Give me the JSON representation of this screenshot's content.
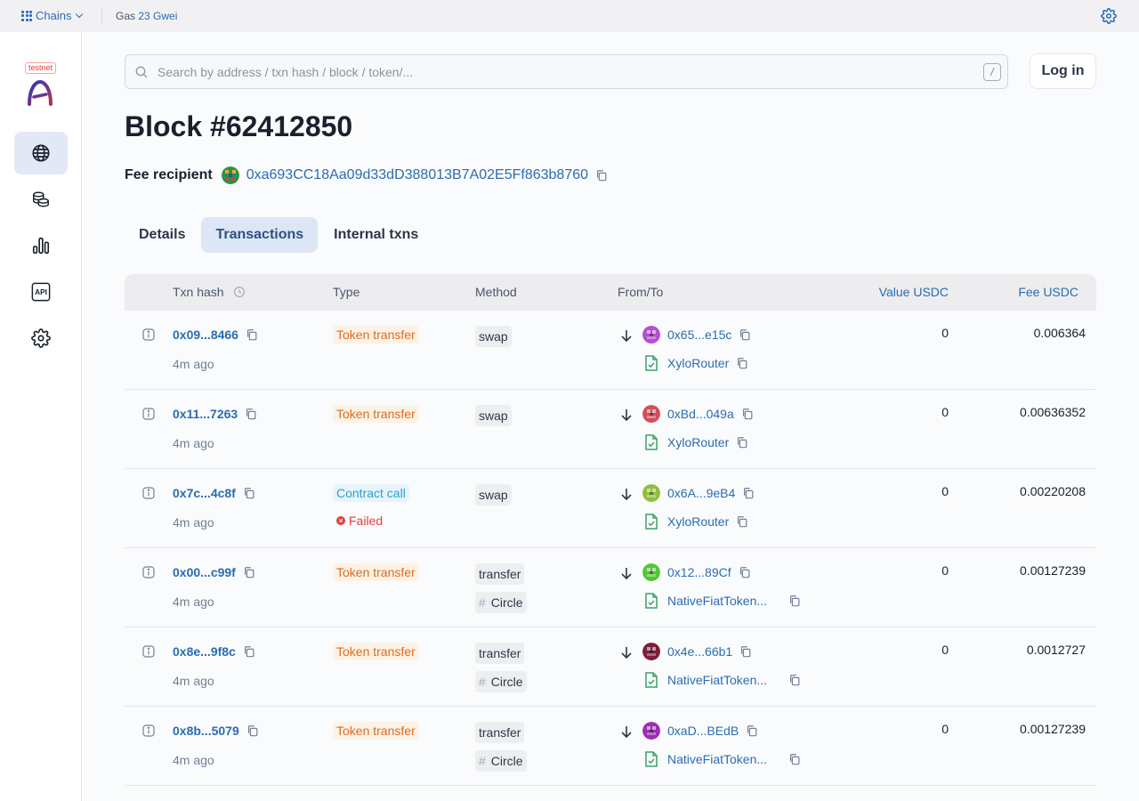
{
  "topbar": {
    "chains_label": "Chains",
    "gas_label": "Gas",
    "gas_value": "23 Gwei"
  },
  "sidebar": {
    "badge": "testnet",
    "items": [
      {
        "name": "globe-icon",
        "active": true
      },
      {
        "name": "coins-icon",
        "active": false
      },
      {
        "name": "bar-chart-icon",
        "active": false
      },
      {
        "name": "api-icon",
        "label": "API",
        "active": false
      },
      {
        "name": "gear-icon",
        "active": false
      }
    ]
  },
  "search": {
    "placeholder": "Search by address / txn hash / block / token/...",
    "shortcut": "/"
  },
  "login_label": "Log in",
  "page": {
    "title": "Block #62412850",
    "fee_recipient_label": "Fee recipient",
    "fee_recipient_address": "0xa693CC18Aa09d33dD388013B7A02E5Ff863b8760"
  },
  "tabs": [
    {
      "label": "Details",
      "active": false
    },
    {
      "label": "Transactions",
      "active": true
    },
    {
      "label": "Internal txns",
      "active": false
    }
  ],
  "table": {
    "headers": {
      "hash": "Txn hash",
      "type": "Type",
      "method": "Method",
      "fromto": "From/To",
      "value": "Value USDC",
      "fee": "Fee USDC"
    },
    "rows": [
      {
        "hash": "0x09...8466",
        "age": "4m ago",
        "type": "Token transfer",
        "type_kind": "token",
        "status": "",
        "method": "swap",
        "method_sub": "",
        "from": "0x65...e15c",
        "to": "XyloRouter",
        "value": "0",
        "fee": "0.006364",
        "avatar_color": "#b44fd1"
      },
      {
        "hash": "0x11...7263",
        "age": "4m ago",
        "type": "Token transfer",
        "type_kind": "token",
        "status": "",
        "method": "swap",
        "method_sub": "",
        "from": "0xBd...049a",
        "to": "XyloRouter",
        "value": "0",
        "fee": "0.00636352",
        "avatar_color": "#d14f5a"
      },
      {
        "hash": "0x7c...4c8f",
        "age": "4m ago",
        "type": "Contract call",
        "type_kind": "contract",
        "status": "Failed",
        "method": "swap",
        "method_sub": "",
        "from": "0x6A...9eB4",
        "to": "XyloRouter",
        "value": "0",
        "fee": "0.00220208",
        "avatar_color": "#8fbf3f"
      },
      {
        "hash": "0x00...c99f",
        "age": "4m ago",
        "type": "Token transfer",
        "type_kind": "token",
        "status": "",
        "method": "transfer",
        "method_sub": "Circle",
        "from": "0x12...89Cf",
        "to": "NativeFiatToken...",
        "value": "0",
        "fee": "0.00127239",
        "avatar_color": "#58c33a"
      },
      {
        "hash": "0x8e...9f8c",
        "age": "4m ago",
        "type": "Token transfer",
        "type_kind": "token",
        "status": "",
        "method": "transfer",
        "method_sub": "Circle",
        "from": "0x4e...66b1",
        "to": "NativeFiatToken...",
        "value": "0",
        "fee": "0.0012727",
        "avatar_color": "#7a1f3a"
      },
      {
        "hash": "0x8b...5079",
        "age": "4m ago",
        "type": "Token transfer",
        "type_kind": "token",
        "status": "",
        "method": "transfer",
        "method_sub": "Circle",
        "from": "0xaD...BEdB",
        "to": "NativeFiatToken...",
        "value": "0",
        "fee": "0.00127239",
        "avatar_color": "#9b2fb0"
      }
    ]
  },
  "colors": {
    "accent": "#2b6cb0",
    "token_badge": "#dd6b20",
    "contract_badge": "#319fc9",
    "failed": "#e53e3e"
  }
}
